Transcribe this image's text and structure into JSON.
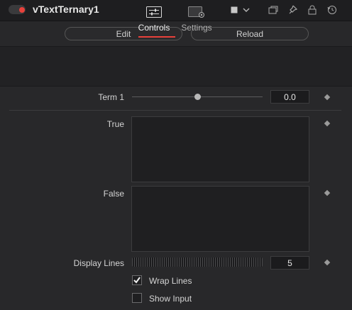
{
  "header": {
    "node_name": "vTextTernary1",
    "toggle_color": "#e8413b",
    "icons": [
      "color-square-icon",
      "chevron-down-icon",
      "window-icon",
      "pin-icon",
      "lock-icon",
      "reset-icon"
    ]
  },
  "buttons": {
    "edit_label": "Edit",
    "reload_label": "Reload"
  },
  "tabs": [
    {
      "label": "Controls",
      "icon": "sliders-icon",
      "active": true
    },
    {
      "label": "Settings",
      "icon": "settings-panel-icon",
      "active": false
    }
  ],
  "controls": {
    "term1": {
      "label": "Term 1",
      "value": "0.0"
    },
    "true_field": {
      "label": "True",
      "value": ""
    },
    "false_field": {
      "label": "False",
      "value": ""
    },
    "display_lines": {
      "label": "Display Lines",
      "value": "5"
    },
    "wrap_lines": {
      "label": "Wrap Lines",
      "checked": true
    },
    "show_input": {
      "label": "Show Input",
      "checked": false
    }
  },
  "colors": {
    "accent": "#e8413b",
    "background": "#28282a"
  }
}
